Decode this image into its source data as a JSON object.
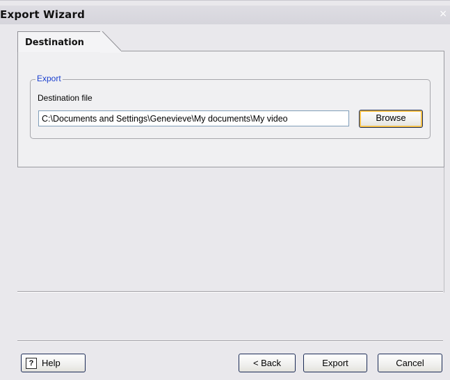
{
  "window": {
    "title": "Export Wizard",
    "close_glyph": "×"
  },
  "tabs": [
    {
      "label": "Destination",
      "active": true
    }
  ],
  "export_group": {
    "legend": "Export",
    "destination_label": "Destination file",
    "destination_value": "C:\\Documents and Settings\\Genevieve\\My documents\\My video",
    "browse_label": "Browse"
  },
  "footer": {
    "help_icon": "question-icon",
    "help_glyph": "?",
    "help_label": "Help",
    "back_label": "< Back",
    "export_label": "Export",
    "cancel_label": "Cancel"
  }
}
